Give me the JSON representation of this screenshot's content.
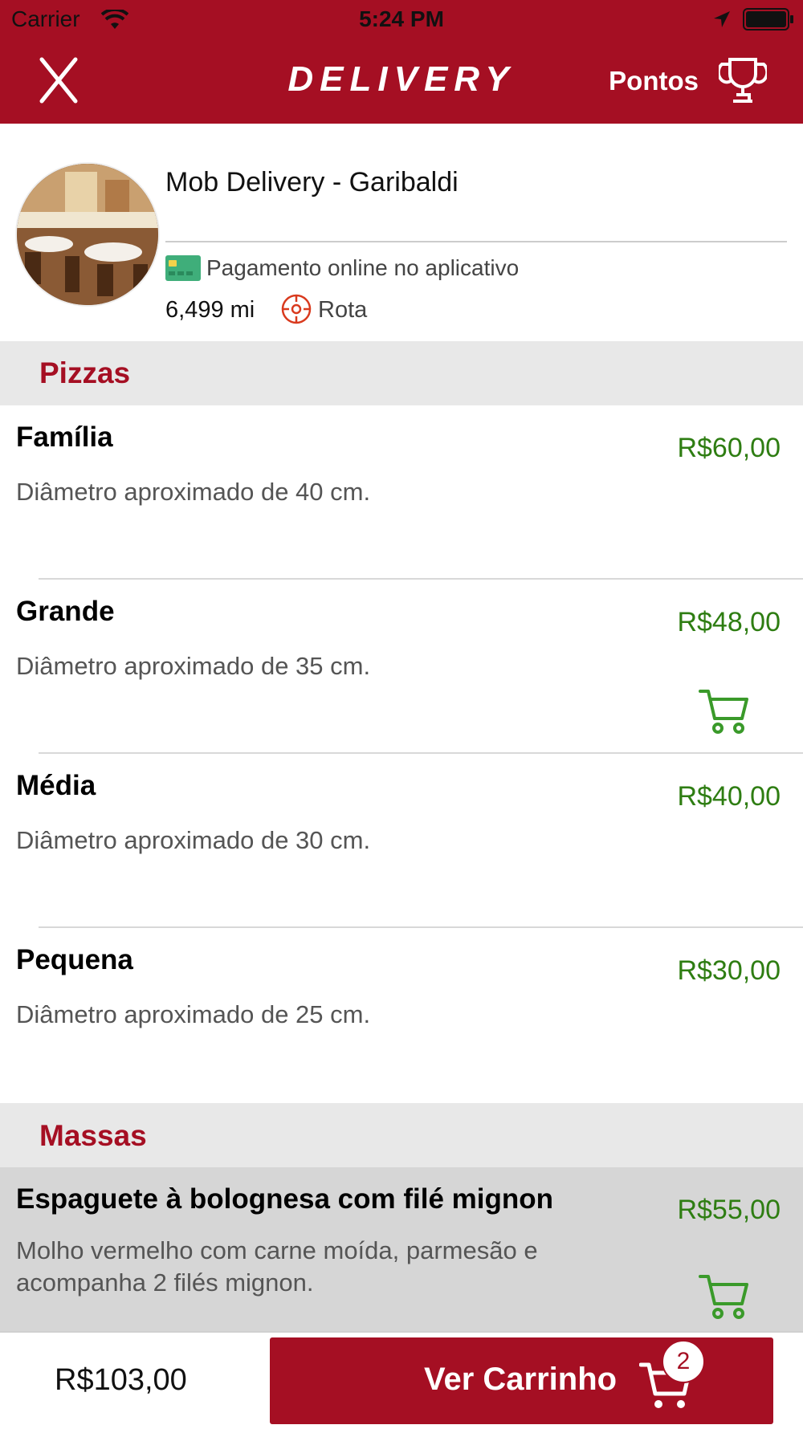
{
  "status_bar": {
    "carrier": "Carrier",
    "time": "5:24 PM"
  },
  "header": {
    "title": "DELIVERY",
    "points_label": "Pontos",
    "colors": {
      "brand": "#a50f23"
    }
  },
  "restaurant": {
    "name": "Mob Delivery - Garibaldi",
    "payment_label": "Pagamento online no aplicativo",
    "distance": "6,499 mi",
    "route_label": "Rota"
  },
  "sections": [
    {
      "title": "Pizzas",
      "items": [
        {
          "name": "Família",
          "description": "Diâmetro aproximado de 40 cm.",
          "price": "R$60,00"
        },
        {
          "name": "Grande",
          "description": "Diâmetro aproximado de 35 cm.",
          "price": "R$48,00"
        },
        {
          "name": "Média",
          "description": "Diâmetro aproximado de 30 cm.",
          "price": "R$40,00"
        },
        {
          "name": "Pequena",
          "description": "Diâmetro aproximado de 25 cm.",
          "price": "R$30,00"
        }
      ]
    },
    {
      "title": "Massas",
      "items": [
        {
          "name": "Espaguete à bolognesa com filé mignon",
          "description": "Molho vermelho com carne moída, parmesão e acompanha 2 filés mignon.",
          "price": "R$55,00"
        }
      ]
    }
  ],
  "footer": {
    "total": "R$103,00",
    "cart_button_label": "Ver Carrinho",
    "cart_count": "2"
  }
}
